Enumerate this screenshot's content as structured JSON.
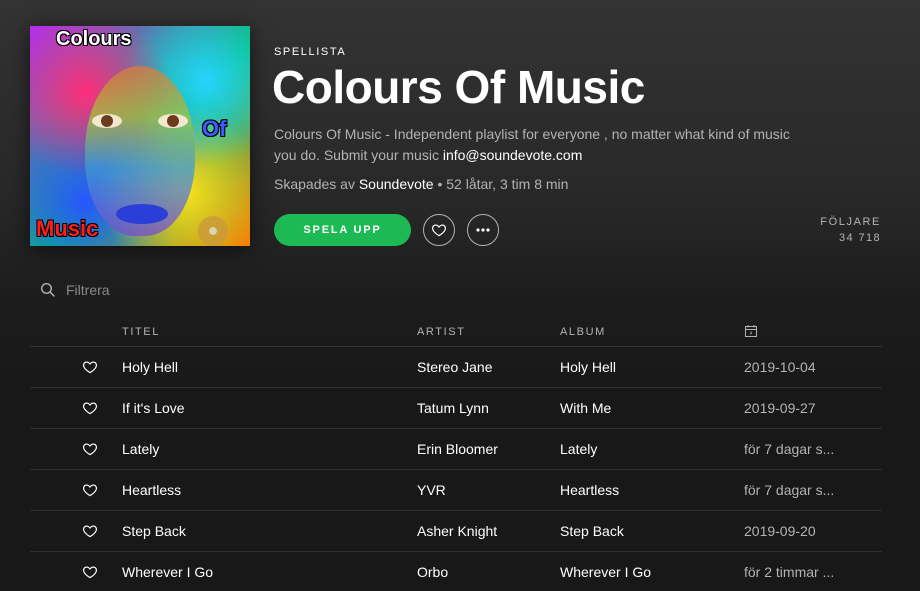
{
  "header": {
    "cover": {
      "word1": "Colours",
      "word2": "Of",
      "word3": "Music"
    },
    "type_label": "SPELLISTA",
    "title": "Colours Of Music",
    "description_text": "Colours Of Music - Independent playlist for everyone , no matter what kind of music you do. Submit your music ",
    "description_email": "info@soundevote.com",
    "created_by_prefix": "Skapades av ",
    "owner": "Soundevote",
    "stats": " • 52 låtar, 3 tim 8 min",
    "play_label": "SPELA UPP",
    "followers_label": "FÖLJARE",
    "followers_count": "34 718",
    "accent_color": "#1db954"
  },
  "filter": {
    "placeholder": "Filtrera",
    "icon": "search-icon"
  },
  "table": {
    "headers": {
      "title": "TITEL",
      "artist": "ARTIST",
      "album": "ALBUM",
      "date_icon": "calendar-icon"
    },
    "rows": [
      {
        "title": "Holy Hell",
        "artist": "Stereo Jane",
        "album": "Holy Hell",
        "date": "2019-10-04"
      },
      {
        "title": "If it's Love",
        "artist": "Tatum Lynn",
        "album": "With Me",
        "date": "2019-09-27"
      },
      {
        "title": "Lately",
        "artist": "Erin Bloomer",
        "album": "Lately",
        "date": "för 7 dagar s..."
      },
      {
        "title": "Heartless",
        "artist": "YVR",
        "album": "Heartless",
        "date": "för 7 dagar s..."
      },
      {
        "title": "Step Back",
        "artist": "Asher Knight",
        "album": "Step Back",
        "date": "2019-09-20"
      },
      {
        "title": "Wherever I Go",
        "artist": "Orbo",
        "album": "Wherever I Go",
        "date": "för 2 timmar ..."
      }
    ]
  }
}
